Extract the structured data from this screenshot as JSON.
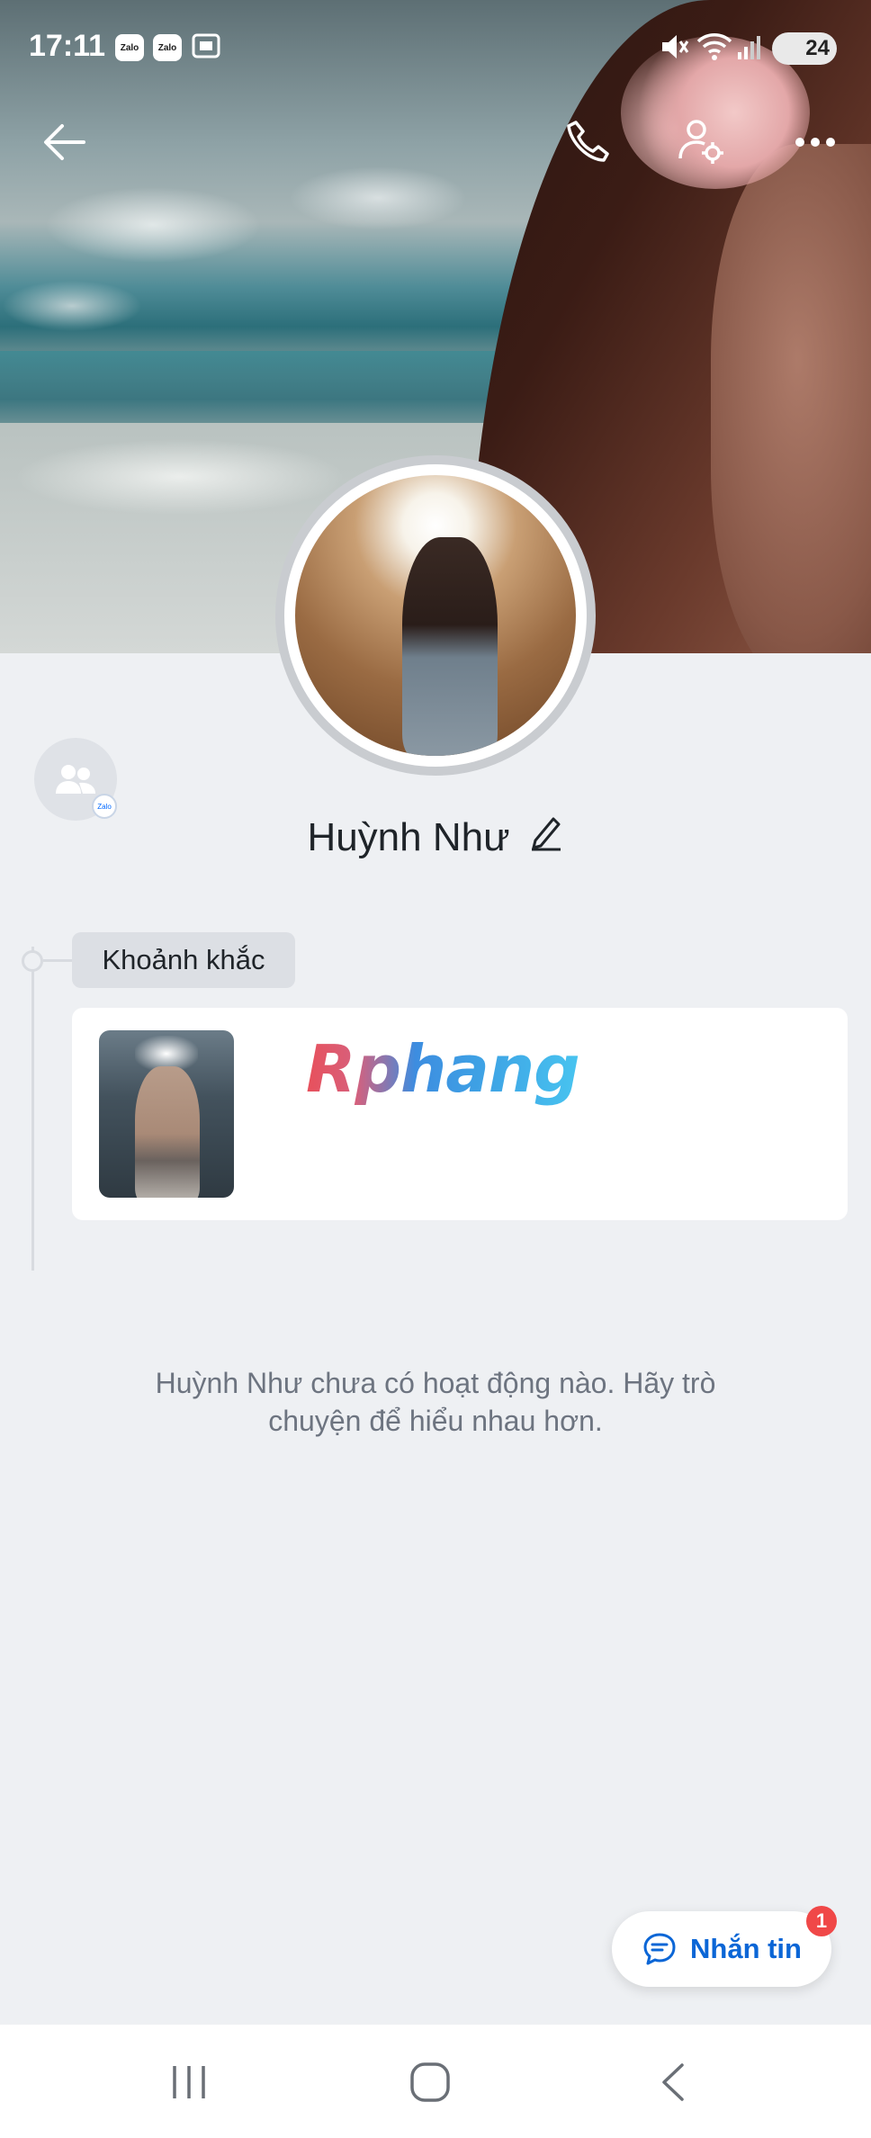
{
  "status_bar": {
    "time": "17:11",
    "notifications": [
      "Zalo",
      "Zalo"
    ],
    "battery": "24"
  },
  "header": {
    "back_icon": "arrow-left-icon",
    "actions": [
      "phone-icon",
      "user-settings-icon",
      "more-icon"
    ]
  },
  "profile": {
    "name": "Huỳnh Như",
    "edit_icon": "pencil-icon"
  },
  "moments": {
    "label": "Khoảnh khắc",
    "watermark": "Rphang"
  },
  "empty_state": {
    "message": "Huỳnh Như chưa có hoạt động nào. Hãy trò chuyện để hiểu nhau hơn."
  },
  "message_button": {
    "label": "Nhắn tin",
    "badge": "1"
  },
  "colors": {
    "accent": "#0b66d6",
    "badge": "#f04848",
    "background": "#eef0f3"
  }
}
